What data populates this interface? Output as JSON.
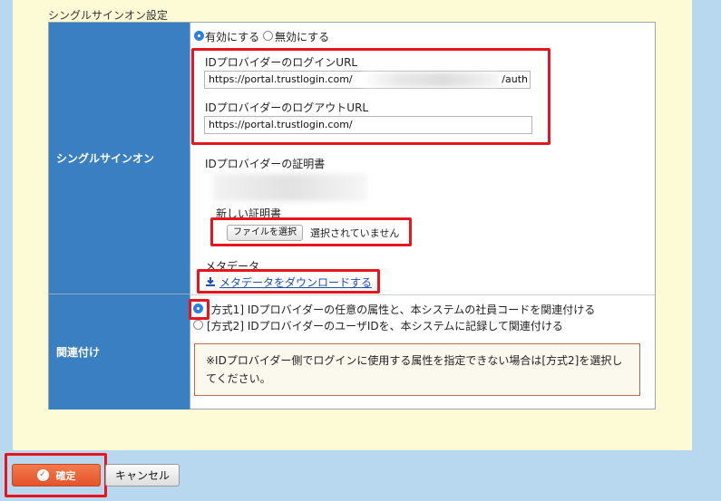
{
  "section": {
    "title": "シングルサインオン設定"
  },
  "sso": {
    "header": "シングルサインオン",
    "enable_label": "有効にする",
    "disable_label": "無効にする",
    "enabled": true,
    "login_url_label": "IDプロバイダーのログインURL",
    "login_url_prefix": "https://portal.trustlogin.com/",
    "login_url_suffix": "/auth",
    "logout_url_label": "IDプロバイダーのログアウトURL",
    "logout_url_value": "https://portal.trustlogin.com/",
    "cert_label": "IDプロバイダーの証明書",
    "new_cert_label": "新しい証明書",
    "file_button": "ファイルを選択",
    "file_status": "選択されていません",
    "metadata_label": "メタデータ",
    "metadata_link": "メタデータをダウンロードする"
  },
  "mapping": {
    "header": "関連付け",
    "option1": "[方式1] IDプロバイダーの任意の属性と、本システムの社員コードを関連付ける",
    "option2": "[方式2] IDプロバイダーのユーザIDを、本システムに記録して関連付ける",
    "selected": 1,
    "note": "※IDプロバイダー側でログインに使用する属性を指定できない場合は[方式2]を選択してください。"
  },
  "buttons": {
    "confirm": "確定",
    "cancel": "キャンセル"
  },
  "colors": {
    "highlight": "#e8141e",
    "header_bg": "#3a7fc2",
    "panel_bg": "#fdfbd5",
    "confirm_bg": "#e4542b"
  }
}
